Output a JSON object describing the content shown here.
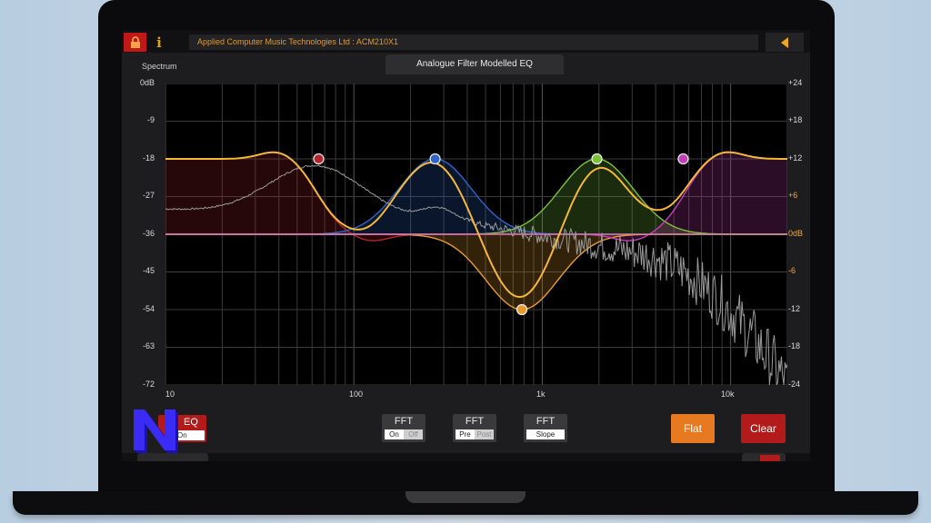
{
  "window": {
    "title": "Applied Computer Music Technologies Ltd  :  ACM210X1",
    "info_glyph": "i",
    "lock_icon": "lock-icon",
    "collapse_icon": "triangle-left-icon"
  },
  "panel": {
    "title": "Analogue Filter Modelled EQ",
    "spectrum_label": "Spectrum"
  },
  "axes": {
    "left_labels": [
      "0dB",
      "-9",
      "-18",
      "-27",
      "-36",
      "-45",
      "-54",
      "-63",
      "-72"
    ],
    "right_labels": [
      "+24",
      "+18",
      "+12",
      "+6",
      "0dB",
      "-6",
      "-12",
      "-18",
      "-24"
    ],
    "right_highlight": [
      "+6",
      "0dB",
      "-6"
    ],
    "x_labels": [
      "10",
      "100",
      "1k",
      "10k"
    ]
  },
  "chart_data": {
    "type": "line",
    "x_scale": "log",
    "xlim": [
      10,
      20000
    ],
    "ylim_left_db": [
      -72,
      0
    ],
    "ylim_right_db": [
      -24,
      24
    ],
    "grid": true,
    "eq_nodes": [
      {
        "band": "low-shelf",
        "freq_hz": 65,
        "gain_db": 12,
        "color": "#b3262e"
      },
      {
        "band": "bell-1",
        "freq_hz": 270,
        "gain_db": 12,
        "color": "#2f64c8"
      },
      {
        "band": "bell-2",
        "freq_hz": 780,
        "gain_db": -12,
        "color": "#e89a2c"
      },
      {
        "band": "bell-3",
        "freq_hz": 1950,
        "gain_db": 12,
        "color": "#7bc23a"
      },
      {
        "band": "high-shelf",
        "freq_hz": 5600,
        "gain_db": 12,
        "color": "#c43cb8"
      }
    ],
    "colors": {
      "response": "#f5b735",
      "spectrum": "#9a9a9a",
      "baseline": "#e07ab8",
      "grid": "#3a3a3a"
    }
  },
  "controls": {
    "eq": {
      "label": "EQ",
      "sub": "On"
    },
    "fft_onoff": {
      "label": "FFT",
      "on": "On",
      "off": "Off"
    },
    "fft_prepost": {
      "label": "FFT",
      "pre": "Pre",
      "post": "Post"
    },
    "fft_slope": {
      "label": "FFT",
      "slope": "Slope"
    },
    "flat": "Flat",
    "clear": "Clear"
  }
}
